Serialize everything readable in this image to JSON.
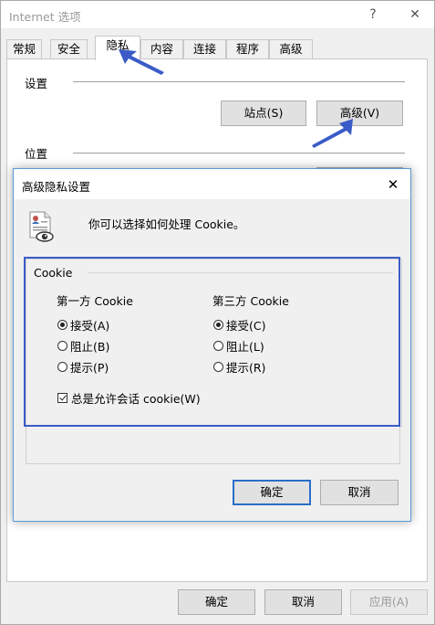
{
  "outer": {
    "title": "Internet 选项",
    "help_label": "?",
    "close_label": "✕",
    "tabs": [
      {
        "label": "常规"
      },
      {
        "label": "安全"
      },
      {
        "label": "隐私"
      },
      {
        "label": "内容"
      },
      {
        "label": "连接"
      },
      {
        "label": "程序"
      },
      {
        "label": "高级"
      }
    ],
    "active_tab": "隐私",
    "settings_label": "设置",
    "sites_button": "站点(S)",
    "advanced_button": "高级(V)",
    "location_label": "位置",
    "ok_button": "确定",
    "cancel_button": "取消",
    "apply_button": "应用(A)"
  },
  "dialog": {
    "title": "高级隐私设置",
    "close_label": "✕",
    "intro_text": "你可以选择如何处理 Cookie。",
    "cookie_group": "Cookie",
    "first_party": {
      "title": "第一方 Cookie",
      "options": [
        "接受(A)",
        "阻止(B)",
        "提示(P)"
      ],
      "selected": "接受(A)"
    },
    "third_party": {
      "title": "第三方 Cookie",
      "options": [
        "接受(C)",
        "阻止(L)",
        "提示(R)"
      ],
      "selected": "接受(C)"
    },
    "session_checkbox": {
      "label": "总是允许会话 cookie(W)",
      "checked": true
    },
    "ok_button": "确定",
    "cancel_button": "取消"
  },
  "colors": {
    "annotation_blue": "#3a5bc7",
    "dialog_border": "#5a9bd6",
    "default_button_border": "#2a6ec8"
  }
}
